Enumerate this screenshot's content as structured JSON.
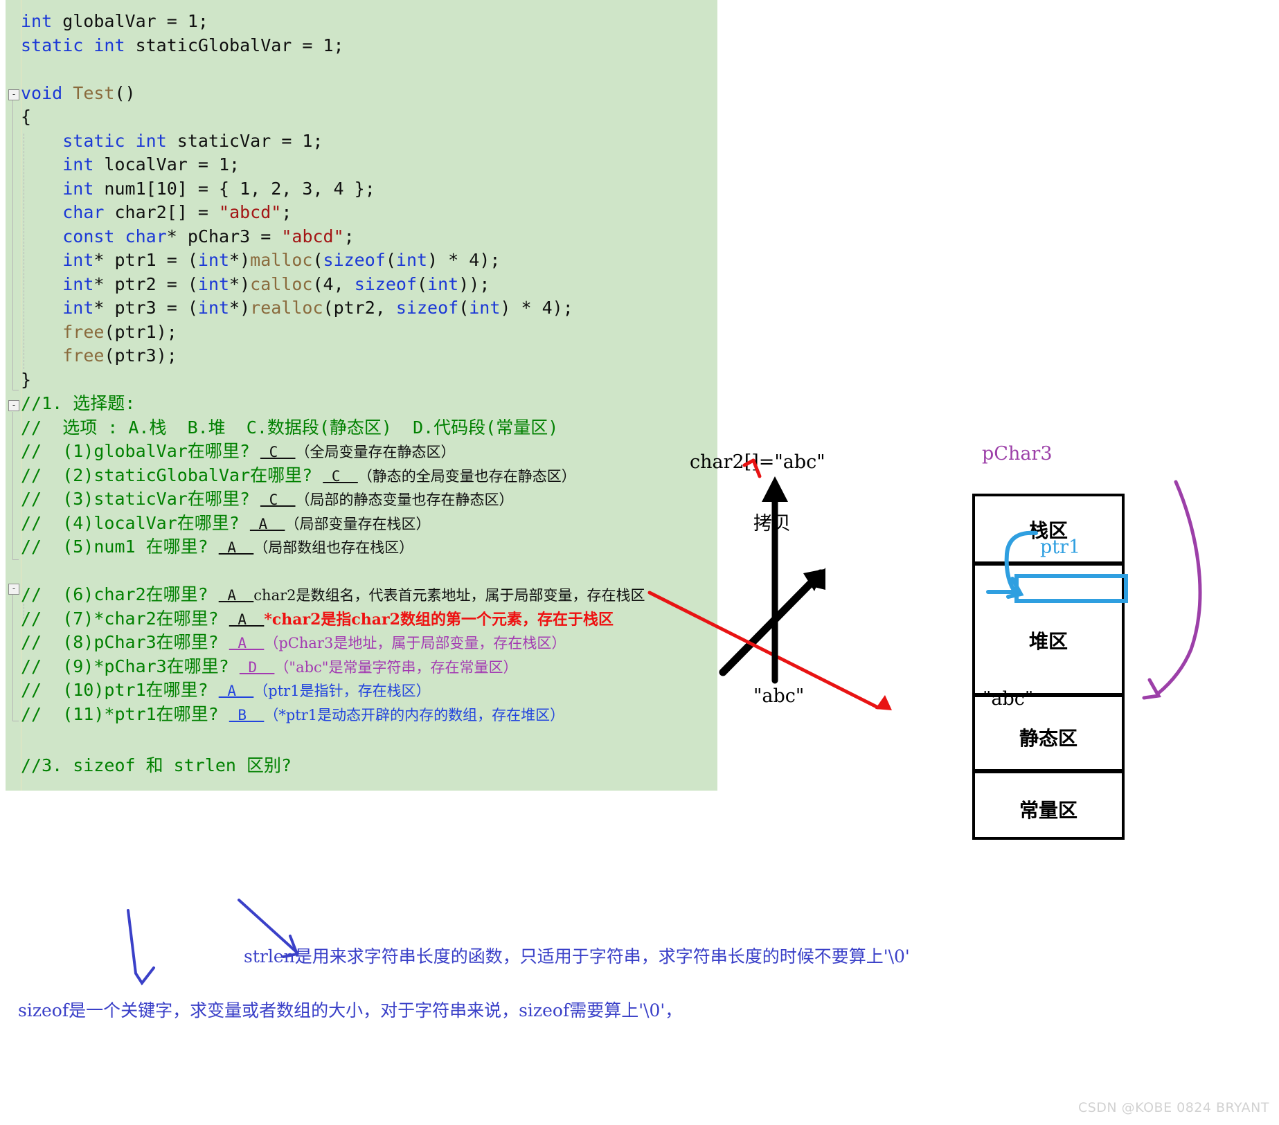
{
  "editor": {
    "background": "#cfe5c8",
    "code": [
      {
        "id": "l1",
        "segs": [
          {
            "t": "int",
            "c": "kw"
          },
          {
            "t": " globalVar = 1;",
            "c": "pl"
          }
        ]
      },
      {
        "id": "l2",
        "segs": [
          {
            "t": "static",
            "c": "kw"
          },
          {
            "t": " ",
            "c": "pl"
          },
          {
            "t": "int",
            "c": "kw"
          },
          {
            "t": " staticGlobalVar = 1;",
            "c": "pl"
          }
        ]
      },
      {
        "id": "l3",
        "segs": []
      },
      {
        "id": "l4",
        "segs": [
          {
            "t": "void",
            "c": "kw"
          },
          {
            "t": " ",
            "c": "pl"
          },
          {
            "t": "Test",
            "c": "fn"
          },
          {
            "t": "()",
            "c": "pl"
          }
        ]
      },
      {
        "id": "l5",
        "segs": [
          {
            "t": "{",
            "c": "pl"
          }
        ]
      },
      {
        "id": "l6",
        "segs": [
          {
            "t": "    ",
            "c": "pl"
          },
          {
            "t": "static",
            "c": "kw"
          },
          {
            "t": " ",
            "c": "pl"
          },
          {
            "t": "int",
            "c": "kw"
          },
          {
            "t": " staticVar = 1;",
            "c": "pl"
          }
        ]
      },
      {
        "id": "l7",
        "segs": [
          {
            "t": "    ",
            "c": "pl"
          },
          {
            "t": "int",
            "c": "kw"
          },
          {
            "t": " localVar = 1;",
            "c": "pl"
          }
        ]
      },
      {
        "id": "l8",
        "segs": [
          {
            "t": "    ",
            "c": "pl"
          },
          {
            "t": "int",
            "c": "kw"
          },
          {
            "t": " num1[10] = { 1, 2, 3, 4 };",
            "c": "pl"
          }
        ]
      },
      {
        "id": "l9",
        "segs": [
          {
            "t": "    ",
            "c": "pl"
          },
          {
            "t": "char",
            "c": "kw"
          },
          {
            "t": " char2[] = ",
            "c": "pl"
          },
          {
            "t": "\"abcd\"",
            "c": "str"
          },
          {
            "t": ";",
            "c": "pl"
          }
        ]
      },
      {
        "id": "l10",
        "segs": [
          {
            "t": "    ",
            "c": "pl"
          },
          {
            "t": "const",
            "c": "kw"
          },
          {
            "t": " ",
            "c": "pl"
          },
          {
            "t": "char",
            "c": "kw"
          },
          {
            "t": "* pChar3 = ",
            "c": "pl"
          },
          {
            "t": "\"abcd\"",
            "c": "str"
          },
          {
            "t": ";",
            "c": "pl"
          }
        ]
      },
      {
        "id": "l11",
        "segs": [
          {
            "t": "    ",
            "c": "pl"
          },
          {
            "t": "int",
            "c": "kw"
          },
          {
            "t": "* ptr1 = (",
            "c": "pl"
          },
          {
            "t": "int",
            "c": "kw"
          },
          {
            "t": "*)",
            "c": "pl"
          },
          {
            "t": "malloc",
            "c": "fn"
          },
          {
            "t": "(",
            "c": "pl"
          },
          {
            "t": "sizeof",
            "c": "kw"
          },
          {
            "t": "(",
            "c": "pl"
          },
          {
            "t": "int",
            "c": "kw"
          },
          {
            "t": ") * 4);",
            "c": "pl"
          }
        ]
      },
      {
        "id": "l12",
        "segs": [
          {
            "t": "    ",
            "c": "pl"
          },
          {
            "t": "int",
            "c": "kw"
          },
          {
            "t": "* ptr2 = (",
            "c": "pl"
          },
          {
            "t": "int",
            "c": "kw"
          },
          {
            "t": "*)",
            "c": "pl"
          },
          {
            "t": "calloc",
            "c": "fn"
          },
          {
            "t": "(4, ",
            "c": "pl"
          },
          {
            "t": "sizeof",
            "c": "kw"
          },
          {
            "t": "(",
            "c": "pl"
          },
          {
            "t": "int",
            "c": "kw"
          },
          {
            "t": "));",
            "c": "pl"
          }
        ]
      },
      {
        "id": "l13",
        "segs": [
          {
            "t": "    ",
            "c": "pl"
          },
          {
            "t": "int",
            "c": "kw"
          },
          {
            "t": "* ptr3 = (",
            "c": "pl"
          },
          {
            "t": "int",
            "c": "kw"
          },
          {
            "t": "*)",
            "c": "pl"
          },
          {
            "t": "realloc",
            "c": "fn"
          },
          {
            "t": "(ptr2, ",
            "c": "pl"
          },
          {
            "t": "sizeof",
            "c": "kw"
          },
          {
            "t": "(",
            "c": "pl"
          },
          {
            "t": "int",
            "c": "kw"
          },
          {
            "t": ") * 4);",
            "c": "pl"
          }
        ]
      },
      {
        "id": "l14",
        "segs": [
          {
            "t": "    ",
            "c": "pl"
          },
          {
            "t": "free",
            "c": "fn"
          },
          {
            "t": "(ptr1);",
            "c": "pl"
          }
        ]
      },
      {
        "id": "l15",
        "segs": [
          {
            "t": "    ",
            "c": "pl"
          },
          {
            "t": "free",
            "c": "fn"
          },
          {
            "t": "(ptr3);",
            "c": "pl"
          }
        ]
      },
      {
        "id": "l16",
        "segs": [
          {
            "t": "}",
            "c": "pl"
          }
        ]
      }
    ],
    "comment_header": [
      {
        "id": "c1",
        "segs": [
          {
            "t": "//1. 选择题:",
            "c": "cm"
          }
        ]
      },
      {
        "id": "c2",
        "segs": [
          {
            "t": "//  选项 : A.栈  B.堆  C.数据段(静态区)  D.代码段(常量区)",
            "c": "cm"
          }
        ]
      }
    ],
    "questions": [
      {
        "id": "q1",
        "prefix": "//  (1)globalVar在哪里? ",
        "answer": "C",
        "answer_color": "blk",
        "note": "（全局变量存在静态区）",
        "note_color": "blk",
        "note_font": "ann"
      },
      {
        "id": "q2",
        "prefix": "//  (2)staticGlobalVar在哪里? ",
        "answer": "C",
        "answer_color": "blk",
        "note": "（静态的全局变量也存在静态区）",
        "note_color": "blk",
        "note_font": "ann"
      },
      {
        "id": "q3",
        "prefix": "//  (3)staticVar在哪里? ",
        "answer": "C",
        "answer_color": "blk",
        "note": "（局部的静态变量也存在静态区）",
        "note_color": "blk",
        "note_font": "ann"
      },
      {
        "id": "q4",
        "prefix": "//  (4)localVar在哪里? ",
        "answer": "A",
        "answer_color": "blk",
        "note": "（局部变量存在栈区）",
        "note_color": "blk",
        "note_font": "ann"
      },
      {
        "id": "q5",
        "prefix": "//  (5)num1 在哪里? ",
        "answer": "A",
        "answer_color": "blk",
        "note": "（局部数组也存在栈区）",
        "note_color": "blk",
        "note_font": "ann"
      },
      {
        "id": "q6",
        "prefix": "//  (6)char2在哪里? ",
        "answer": "A",
        "answer_color": "blk",
        "note": "char2是数组名，代表首元素地址，属于局部变量，存在栈区",
        "note_color": "blk",
        "note_font": "ann"
      },
      {
        "id": "q7",
        "prefix": "//  (7)*char2在哪里? ",
        "answer": "A",
        "answer_color": "blk",
        "note": "*char2是指char2数组的第一个元素，存在于栈区",
        "note_color": "red",
        "note_font": "annb"
      },
      {
        "id": "q8",
        "prefix": "//  (8)pChar3在哪里? ",
        "answer": "A",
        "answer_color": "pur",
        "note": "（pChar3是地址，属于局部变量，存在栈区）",
        "note_color": "pur",
        "note_font": "ann"
      },
      {
        "id": "q9",
        "prefix": "//  (9)*pChar3在哪里? ",
        "answer": "D",
        "answer_color": "pur",
        "note": "（\"abc\"是常量字符串，存在常量区）",
        "note_color": "pur",
        "note_font": "ann"
      },
      {
        "id": "q10",
        "prefix": "//  (10)ptr1在哪里? ",
        "answer": "A",
        "answer_color": "blu",
        "note": "（ptr1是指针，存在栈区）",
        "note_color": "blu",
        "note_font": "ann"
      },
      {
        "id": "q11",
        "prefix": "//  (11)*ptr1在哪里? ",
        "answer": "B",
        "answer_color": "blu",
        "note": "（*ptr1是动态开辟的内存的数组，存在堆区）",
        "note_color": "blu",
        "note_font": "ann"
      }
    ],
    "footer_comment": "//3. sizeof 和 strlen 区别?"
  },
  "diagram": {
    "regions": [
      {
        "id": "stack",
        "label": "栈区"
      },
      {
        "id": "heap",
        "label": "堆区"
      },
      {
        "id": "static",
        "label": "静态区"
      },
      {
        "id": "const",
        "label": "常量区"
      }
    ],
    "ptr1_label": "ptr1",
    "ptr1_color": "#2f9fe0",
    "pchar3_label": "pChar3",
    "pchar3_color": "#9c3fa8",
    "char2_label": "char2[]=\"abc\"",
    "copy_label": "拷贝",
    "abc_left_label": "\"abc\"",
    "abc_right_label": "\"abc\""
  },
  "notes": {
    "strlen_note": "strlen是用来求字符串长度的函数，只适用于字符串，求字符串长度的时候不要算上'\\0'",
    "sizeof_note": "sizeof是一个关键字，求变量或者数组的大小，对于字符串来说，sizeof需要算上'\\0'，",
    "note_color": "#3a40c8"
  },
  "watermark": "CSDN @KOBE 0824 BRYANT"
}
